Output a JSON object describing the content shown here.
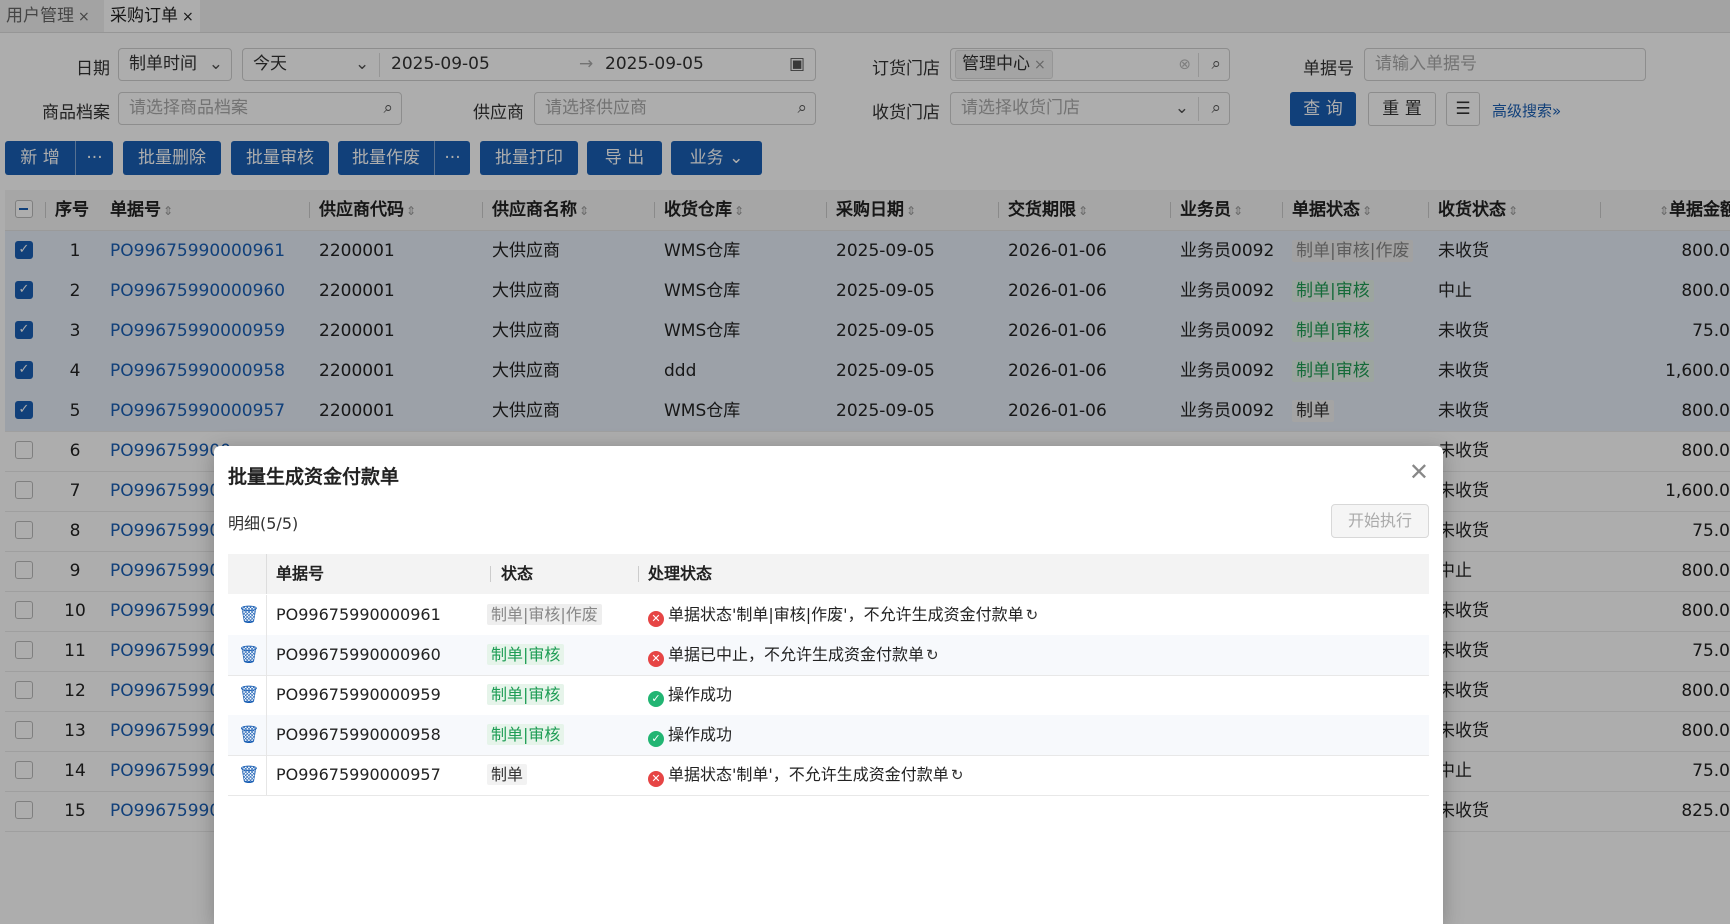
{
  "tabs": [
    {
      "label": "用户管理",
      "close": "×"
    },
    {
      "label": "采购订单",
      "close": "×"
    }
  ],
  "filters": {
    "date_label": "日期",
    "date_type": "制单时间",
    "date_range_preset": "今天",
    "date_from": "2025-09-05",
    "date_to": "2025-09-05",
    "date_arrow": "→",
    "store_label": "订货门店",
    "store_tag": "管理中心",
    "doc_no_label": "单据号",
    "doc_no_placeholder": "请输入单据号",
    "product_label": "商品档案",
    "product_placeholder": "请选择商品档案",
    "supplier_label": "供应商",
    "supplier_placeholder": "请选择供应商",
    "receive_store_label": "收货门店",
    "receive_store_placeholder": "请选择收货门店",
    "query_btn": "查 询",
    "reset_btn": "重 置",
    "advanced_link": "高级搜索»"
  },
  "toolbar": {
    "add": "新 增",
    "more": "···",
    "batch_delete": "批量删除",
    "batch_audit": "批量审核",
    "batch_void": "批量作废",
    "batch_print": "批量打印",
    "export": "导 出",
    "business": "业务"
  },
  "grid": {
    "headers": {
      "seq": "序号",
      "doc_no": "单据号",
      "supplier_code": "供应商代码",
      "supplier_name": "供应商名称",
      "warehouse": "收货仓库",
      "purchase_date": "采购日期",
      "delivery_date": "交货期限",
      "salesman": "业务员",
      "doc_status": "单据状态",
      "receive_status": "收货状态",
      "amount": "单据金额"
    },
    "rows": [
      {
        "seq": "1",
        "doc_no": "PO99675990000961",
        "supplier_code": "2200001",
        "supplier_name": "大供应商",
        "warehouse": "WMS仓库",
        "purchase_date": "2025-09-05",
        "delivery_date": "2026-01-06",
        "salesman": "业务员0092",
        "doc_status": "制单|审核|作废",
        "receive_status": "未收货",
        "amount": "800.0"
      },
      {
        "seq": "2",
        "doc_no": "PO99675990000960",
        "supplier_code": "2200001",
        "supplier_name": "大供应商",
        "warehouse": "WMS仓库",
        "purchase_date": "2025-09-05",
        "delivery_date": "2026-01-06",
        "salesman": "业务员0092",
        "doc_status": "制单|审核",
        "receive_status": "中止",
        "amount": "800.0"
      },
      {
        "seq": "3",
        "doc_no": "PO99675990000959",
        "supplier_code": "2200001",
        "supplier_name": "大供应商",
        "warehouse": "WMS仓库",
        "purchase_date": "2025-09-05",
        "delivery_date": "2026-01-06",
        "salesman": "业务员0092",
        "doc_status": "制单|审核",
        "receive_status": "未收货",
        "amount": "75.0"
      },
      {
        "seq": "4",
        "doc_no": "PO99675990000958",
        "supplier_code": "2200001",
        "supplier_name": "大供应商",
        "warehouse": "ddd",
        "purchase_date": "2025-09-05",
        "delivery_date": "2026-01-06",
        "salesman": "业务员0092",
        "doc_status": "制单|审核",
        "receive_status": "未收货",
        "amount": "1,600.0"
      },
      {
        "seq": "5",
        "doc_no": "PO99675990000957",
        "supplier_code": "2200001",
        "supplier_name": "大供应商",
        "warehouse": "WMS仓库",
        "purchase_date": "2025-09-05",
        "delivery_date": "2026-01-06",
        "salesman": "业务员0092",
        "doc_status": "制单",
        "receive_status": "未收货",
        "amount": "800.0"
      },
      {
        "seq": "6",
        "doc_no": "PO996759900",
        "receive_status": "未收货",
        "amount": "800.0"
      },
      {
        "seq": "7",
        "doc_no": "PO996759900",
        "receive_status": "未收货",
        "amount": "1,600.0"
      },
      {
        "seq": "8",
        "doc_no": "PO996759900",
        "receive_status": "未收货",
        "amount": "75.0"
      },
      {
        "seq": "9",
        "doc_no": "PO996759900",
        "receive_status": "中止",
        "amount": "800.0"
      },
      {
        "seq": "10",
        "doc_no": "PO996759900",
        "receive_status": "未收货",
        "amount": "800.0"
      },
      {
        "seq": "11",
        "doc_no": "PO996759900",
        "receive_status": "未收货",
        "amount": "75.0"
      },
      {
        "seq": "12",
        "doc_no": "PO996759900",
        "receive_status": "未收货",
        "amount": "800.0"
      },
      {
        "seq": "13",
        "doc_no": "PO996759900",
        "receive_status": "未收货",
        "amount": "800.0"
      },
      {
        "seq": "14",
        "doc_no": "PO996759900",
        "receive_status": "中止",
        "amount": "75.0"
      },
      {
        "seq": "15",
        "doc_no": "PO996759900",
        "receive_status": "未收货",
        "amount": "825.0"
      }
    ]
  },
  "modal": {
    "title": "批量生成资金付款单",
    "subtitle": "明细(5/5)",
    "exec_btn": "开始执行",
    "headers": {
      "doc_no": "单据号",
      "status": "状态",
      "process": "处理状态"
    },
    "rows": [
      {
        "doc_no": "PO99675990000961",
        "status": "制单|审核|作废",
        "status_kind": "grey",
        "result": "error",
        "message": "单据状态'制单|审核|作废'，不允许生成资金付款单",
        "retry": true
      },
      {
        "doc_no": "PO99675990000960",
        "status": "制单|审核",
        "status_kind": "green",
        "result": "error",
        "message": "单据已中止，不允许生成资金付款单",
        "retry": true
      },
      {
        "doc_no": "PO99675990000959",
        "status": "制单|审核",
        "status_kind": "green",
        "result": "ok",
        "message": "操作成功",
        "retry": false
      },
      {
        "doc_no": "PO99675990000958",
        "status": "制单|审核",
        "status_kind": "green",
        "result": "ok",
        "message": "操作成功",
        "retry": false
      },
      {
        "doc_no": "PO99675990000957",
        "status": "制单",
        "status_kind": "plain",
        "result": "error",
        "message": "单据状态'制单'，不允许生成资金付款单",
        "retry": true
      }
    ]
  },
  "colors": {
    "accent": "#1a5fb4",
    "success": "#22b573",
    "error": "#e64545"
  }
}
